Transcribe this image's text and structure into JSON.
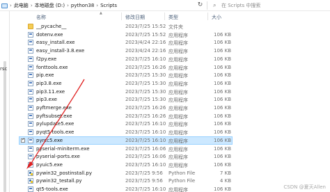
{
  "address": {
    "segments": [
      "此电脑",
      "本地磁盘 (D:)",
      "python38",
      "Scripts"
    ],
    "search_placeholder": "在 Scripts 中搜索"
  },
  "nav": {
    "partial_label": "rsc"
  },
  "columns": {
    "name": "名称",
    "date": "修改日期",
    "type": "类型",
    "size": "大小"
  },
  "files": [
    {
      "name": "__pycache__",
      "date": "2023/7/25 15:52",
      "type": "文件夹",
      "size": "",
      "icon": "folder-icon",
      "selected": false
    },
    {
      "name": "dotenv.exe",
      "date": "2023/7/25 15:52",
      "type": "应用程序",
      "size": "106 KB",
      "icon": "exe-icon",
      "selected": false
    },
    {
      "name": "easy_install.exe",
      "date": "2023/4/24 22:16",
      "type": "应用程序",
      "size": "106 KB",
      "icon": "exe-icon",
      "selected": false
    },
    {
      "name": "easy_install-3.8.exe",
      "date": "2023/4/24 22:16",
      "type": "应用程序",
      "size": "106 KB",
      "icon": "exe-icon",
      "selected": false
    },
    {
      "name": "f2py.exe",
      "date": "2023/7/25 16:10",
      "type": "应用程序",
      "size": "106 KB",
      "icon": "exe-icon",
      "selected": false
    },
    {
      "name": "fonttools.exe",
      "date": "2023/7/25 16:26",
      "type": "应用程序",
      "size": "106 KB",
      "icon": "exe-icon",
      "selected": false
    },
    {
      "name": "pip.exe",
      "date": "2023/7/25 15:30",
      "type": "应用程序",
      "size": "106 KB",
      "icon": "exe-icon",
      "selected": false
    },
    {
      "name": "pip3.8.exe",
      "date": "2023/7/25 15:30",
      "type": "应用程序",
      "size": "106 KB",
      "icon": "exe-icon",
      "selected": false
    },
    {
      "name": "pip3.11.exe",
      "date": "2023/7/25 15:30",
      "type": "应用程序",
      "size": "106 KB",
      "icon": "exe-icon",
      "selected": false
    },
    {
      "name": "pip3.exe",
      "date": "2023/7/25 15:30",
      "type": "应用程序",
      "size": "106 KB",
      "icon": "exe-icon",
      "selected": false
    },
    {
      "name": "pyftmerge.exe",
      "date": "2023/7/25 16:26",
      "type": "应用程序",
      "size": "106 KB",
      "icon": "exe-icon",
      "selected": false
    },
    {
      "name": "pyftsubset.exe",
      "date": "2023/7/25 16:26",
      "type": "应用程序",
      "size": "106 KB",
      "icon": "exe-icon",
      "selected": false
    },
    {
      "name": "pylupdate5.exe",
      "date": "2023/7/25 16:10",
      "type": "应用程序",
      "size": "106 KB",
      "icon": "exe-icon",
      "selected": false
    },
    {
      "name": "pyqt5-tools.exe",
      "date": "2023/7/25 16:10",
      "type": "应用程序",
      "size": "106 KB",
      "icon": "exe-icon",
      "selected": false
    },
    {
      "name": "pyrcc5.exe",
      "date": "2023/7/25 16:10",
      "type": "应用程序",
      "size": "106 KB",
      "icon": "exe-icon",
      "selected": true
    },
    {
      "name": "pyserial-miniterm.exe",
      "date": "2023/7/25 16:06",
      "type": "应用程序",
      "size": "106 KB",
      "icon": "exe-icon",
      "selected": false
    },
    {
      "name": "pyserial-ports.exe",
      "date": "2023/7/25 16:06",
      "type": "应用程序",
      "size": "106 KB",
      "icon": "exe-icon",
      "selected": false
    },
    {
      "name": "pyuic5.exe",
      "date": "2023/7/25 16:10",
      "type": "应用程序",
      "size": "106 KB",
      "icon": "exe-icon",
      "selected": false
    },
    {
      "name": "pywin32_postinstall.py",
      "date": "2023/7/25 9:56",
      "type": "Python File",
      "size": "7 KB",
      "icon": "python-file-icon",
      "selected": false
    },
    {
      "name": "pywin32_testall.py",
      "date": "2023/7/25 9:56",
      "type": "Python File",
      "size": "4 KB",
      "icon": "python-file-icon",
      "selected": false
    },
    {
      "name": "qt5-tools.exe",
      "date": "2023/7/25 16:10",
      "type": "应用程序",
      "size": "106 KB",
      "icon": "exe-icon",
      "selected": false
    }
  ],
  "watermark": "CSDN @夏天Allen",
  "colors": {
    "selection": "#cce8ff",
    "arrow": "#e02020",
    "folder": "#f4cc55"
  }
}
